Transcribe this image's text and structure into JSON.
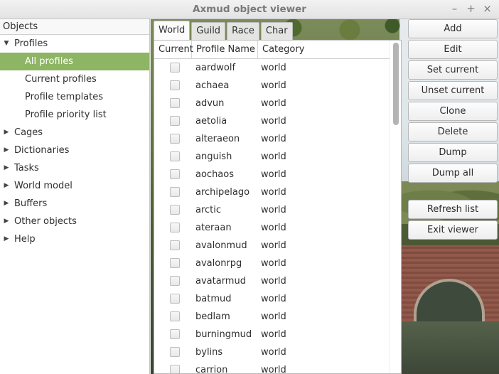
{
  "window": {
    "title": "Axmud object viewer",
    "controls": {
      "minimize": "–",
      "maximize": "+",
      "close": "×"
    }
  },
  "tree": {
    "header": "Objects",
    "items": [
      {
        "label": "Profiles",
        "expanded": true,
        "level": 0
      },
      {
        "label": "All profiles",
        "level": 1,
        "selected": true
      },
      {
        "label": "Current profiles",
        "level": 1
      },
      {
        "label": "Profile templates",
        "level": 1
      },
      {
        "label": "Profile priority list",
        "level": 1
      },
      {
        "label": "Cages",
        "expanded": false,
        "level": 0
      },
      {
        "label": "Dictionaries",
        "expanded": false,
        "level": 0
      },
      {
        "label": "Tasks",
        "expanded": false,
        "level": 0
      },
      {
        "label": "World model",
        "expanded": false,
        "level": 0
      },
      {
        "label": "Buffers",
        "expanded": false,
        "level": 0
      },
      {
        "label": "Other objects",
        "expanded": false,
        "level": 0
      },
      {
        "label": "Help",
        "expanded": false,
        "level": 0
      }
    ]
  },
  "tabs": [
    {
      "label": "World",
      "active": true
    },
    {
      "label": "Guild",
      "active": false
    },
    {
      "label": "Race",
      "active": false
    },
    {
      "label": "Char",
      "active": false
    }
  ],
  "table": {
    "columns": [
      "Current",
      "Profile Name",
      "Category"
    ],
    "rows": [
      {
        "current": false,
        "name": "aardwolf",
        "category": "world"
      },
      {
        "current": false,
        "name": "achaea",
        "category": "world"
      },
      {
        "current": false,
        "name": "advun",
        "category": "world"
      },
      {
        "current": false,
        "name": "aetolia",
        "category": "world"
      },
      {
        "current": false,
        "name": "alteraeon",
        "category": "world"
      },
      {
        "current": false,
        "name": "anguish",
        "category": "world"
      },
      {
        "current": false,
        "name": "aochaos",
        "category": "world"
      },
      {
        "current": false,
        "name": "archipelago",
        "category": "world"
      },
      {
        "current": false,
        "name": "arctic",
        "category": "world"
      },
      {
        "current": false,
        "name": "ateraan",
        "category": "world"
      },
      {
        "current": false,
        "name": "avalonmud",
        "category": "world"
      },
      {
        "current": false,
        "name": "avalonrpg",
        "category": "world"
      },
      {
        "current": false,
        "name": "avatarmud",
        "category": "world"
      },
      {
        "current": false,
        "name": "batmud",
        "category": "world"
      },
      {
        "current": false,
        "name": "bedlam",
        "category": "world"
      },
      {
        "current": false,
        "name": "burningmud",
        "category": "world"
      },
      {
        "current": false,
        "name": "bylins",
        "category": "world"
      },
      {
        "current": false,
        "name": "carrion",
        "category": "world"
      }
    ]
  },
  "buttons": {
    "add": "Add",
    "edit": "Edit",
    "set_current": "Set current",
    "unset_current": "Unset current",
    "clone": "Clone",
    "delete": "Delete",
    "dump": "Dump",
    "dump_all": "Dump all",
    "refresh_list": "Refresh list",
    "exit_viewer": "Exit viewer"
  },
  "colors": {
    "selection": "#8db564",
    "window_bg": "#e8e8e7"
  }
}
